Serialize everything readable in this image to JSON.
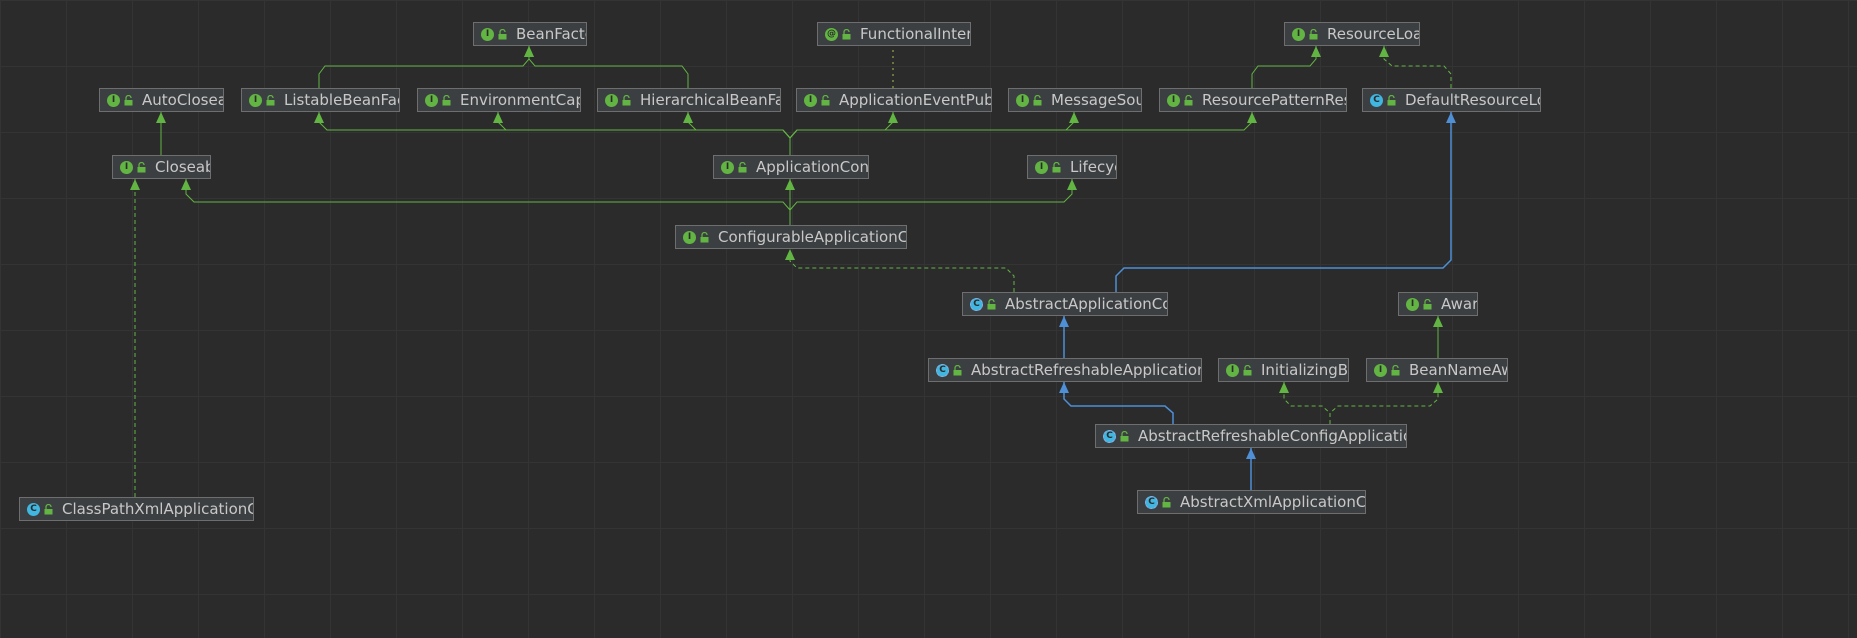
{
  "diagram": {
    "colors": {
      "extends_interface": "#62b543",
      "extends_class": "#4e8fd6",
      "implements": "#62b543",
      "annotation": "#a6c44c",
      "node_bg": "#3c3f41",
      "node_border": "#6e6e6e",
      "text": "#c8c8c8"
    },
    "nodes": [
      {
        "id": "BeanFactory",
        "label": "BeanFactory",
        "kind": "I",
        "icon": "interface-icon"
      },
      {
        "id": "FunctionalInterface",
        "label": "FunctionalInterface",
        "kind": "AN",
        "icon": "annotation-icon"
      },
      {
        "id": "ResourceLoader",
        "label": "ResourceLoader",
        "kind": "I",
        "icon": "interface-icon"
      },
      {
        "id": "AutoCloseable",
        "label": "AutoCloseable",
        "kind": "I",
        "icon": "interface-icon"
      },
      {
        "id": "ListableBeanFactory",
        "label": "ListableBeanFactory",
        "kind": "I",
        "icon": "interface-icon"
      },
      {
        "id": "EnvironmentCapable",
        "label": "EnvironmentCapable",
        "kind": "I",
        "icon": "interface-icon"
      },
      {
        "id": "HierarchicalBeanFactory",
        "label": "HierarchicalBeanFactory",
        "kind": "I",
        "icon": "interface-icon"
      },
      {
        "id": "ApplicationEventPublisher",
        "label": "ApplicationEventPublisher",
        "kind": "I",
        "icon": "interface-icon"
      },
      {
        "id": "MessageSource",
        "label": "MessageSource",
        "kind": "I",
        "icon": "interface-icon"
      },
      {
        "id": "ResourcePatternResolver",
        "label": "ResourcePatternResolve",
        "kind": "I",
        "icon": "interface-icon"
      },
      {
        "id": "DefaultResourceLoader",
        "label": "DefaultResourceLoader",
        "kind": "C",
        "icon": "class-icon"
      },
      {
        "id": "Closeable",
        "label": "Closeable",
        "kind": "I",
        "icon": "interface-icon"
      },
      {
        "id": "ApplicationContext",
        "label": "ApplicationContext",
        "kind": "I",
        "icon": "interface-icon"
      },
      {
        "id": "Lifecycle",
        "label": "Lifecycle",
        "kind": "I",
        "icon": "interface-icon"
      },
      {
        "id": "ConfigurableApplicationContext",
        "label": "ConfigurableApplicationContex",
        "kind": "I",
        "icon": "interface-icon"
      },
      {
        "id": "AbstractApplicationContext",
        "label": "AbstractApplicationContext",
        "kind": "AC",
        "icon": "abstract-class-icon"
      },
      {
        "id": "Aware",
        "label": "Aware",
        "kind": "I",
        "icon": "interface-icon"
      },
      {
        "id": "AbstractRefreshableApplicationContext",
        "label": "AbstractRefreshableApplicationContex",
        "kind": "AC",
        "icon": "abstract-class-icon"
      },
      {
        "id": "InitializingBean",
        "label": "InitializingBean",
        "kind": "I",
        "icon": "interface-icon"
      },
      {
        "id": "BeanNameAware",
        "label": "BeanNameAware",
        "kind": "I",
        "icon": "interface-icon"
      },
      {
        "id": "AbstractRefreshableConfigApplicationContext",
        "label": "AbstractRefreshableConfigApplicationContex",
        "kind": "AC",
        "icon": "abstract-class-icon"
      },
      {
        "id": "ClassPathXmlApplicationContext",
        "label": "ClassPathXmlApplicationContext",
        "kind": "C",
        "icon": "class-icon"
      },
      {
        "id": "AbstractXmlApplicationContext",
        "label": "AbstractXmlApplicationContext",
        "kind": "AC",
        "icon": "abstract-class-icon"
      }
    ],
    "edges": [
      {
        "from": "ListableBeanFactory",
        "to": "BeanFactory",
        "type": "extends_interface"
      },
      {
        "from": "HierarchicalBeanFactory",
        "to": "BeanFactory",
        "type": "extends_interface"
      },
      {
        "from": "ApplicationEventPublisher",
        "to": "FunctionalInterface",
        "type": "annotation"
      },
      {
        "from": "ResourcePatternResolver",
        "to": "ResourceLoader",
        "type": "extends_interface"
      },
      {
        "from": "DefaultResourceLoader",
        "to": "ResourceLoader",
        "type": "implements"
      },
      {
        "from": "Closeable",
        "to": "AutoCloseable",
        "type": "extends_interface"
      },
      {
        "from": "ApplicationContext",
        "to": "ListableBeanFactory",
        "type": "extends_interface"
      },
      {
        "from": "ApplicationContext",
        "to": "EnvironmentCapable",
        "type": "extends_interface"
      },
      {
        "from": "ApplicationContext",
        "to": "HierarchicalBeanFactory",
        "type": "extends_interface"
      },
      {
        "from": "ApplicationContext",
        "to": "ApplicationEventPublisher",
        "type": "extends_interface"
      },
      {
        "from": "ApplicationContext",
        "to": "MessageSource",
        "type": "extends_interface"
      },
      {
        "from": "ApplicationContext",
        "to": "ResourcePatternResolver",
        "type": "extends_interface"
      },
      {
        "from": "ConfigurableApplicationContext",
        "to": "Closeable",
        "type": "extends_interface"
      },
      {
        "from": "ConfigurableApplicationContext",
        "to": "ApplicationContext",
        "type": "extends_interface"
      },
      {
        "from": "ConfigurableApplicationContext",
        "to": "Lifecycle",
        "type": "extends_interface"
      },
      {
        "from": "AbstractApplicationContext",
        "to": "ConfigurableApplicationContext",
        "type": "implements"
      },
      {
        "from": "AbstractApplicationContext",
        "to": "DefaultResourceLoader",
        "type": "extends_class"
      },
      {
        "from": "AbstractRefreshableApplicationContext",
        "to": "AbstractApplicationContext",
        "type": "extends_class"
      },
      {
        "from": "BeanNameAware",
        "to": "Aware",
        "type": "extends_interface"
      },
      {
        "from": "AbstractRefreshableConfigApplicationContext",
        "to": "AbstractRefreshableApplicationContext",
        "type": "extends_class"
      },
      {
        "from": "AbstractRefreshableConfigApplicationContext",
        "to": "InitializingBean",
        "type": "implements"
      },
      {
        "from": "AbstractRefreshableConfigApplicationContext",
        "to": "BeanNameAware",
        "type": "implements"
      },
      {
        "from": "AbstractXmlApplicationContext",
        "to": "AbstractRefreshableConfigApplicationContext",
        "type": "extends_class"
      },
      {
        "from": "ClassPathXmlApplicationContext",
        "to": "Closeable",
        "type": "implements"
      }
    ]
  }
}
